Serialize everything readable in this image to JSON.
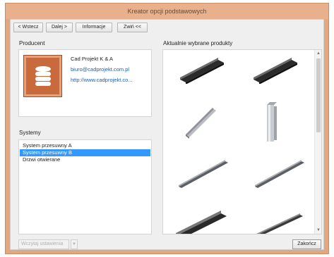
{
  "window": {
    "title": "Kreator opcji podstawowych"
  },
  "toolbar": {
    "back_label": "< Wstecz",
    "next_label": "Dalej >",
    "info_label": "Informacje",
    "collapse_label": "Zwiń <<"
  },
  "producer": {
    "section_label": "Producent",
    "logo_icon": "database-icon",
    "name": "Cad Projekt K & A",
    "email": "biuro@cadprojekt.com.pl",
    "website": "http://www.cadprojekt.co..."
  },
  "systems": {
    "section_label": "Systemy",
    "items": [
      {
        "label": "System przesuwny A",
        "selected": false
      },
      {
        "label": "System przesuwny B",
        "selected": true
      },
      {
        "label": "Drzwi otwierane",
        "selected": false
      }
    ],
    "selection_color": "#3399ff"
  },
  "products": {
    "section_label": "Aktualnie wybrane produkty",
    "items": [
      "aluminium-profile-icon",
      "aluminium-profile-icon",
      "aluminium-profile-icon",
      "aluminium-profile-icon",
      "aluminium-profile-icon",
      "aluminium-profile-icon",
      "aluminium-profile-icon",
      "aluminium-profile-icon"
    ]
  },
  "footer": {
    "load_settings_label": "Wczytaj ustawienia",
    "finish_label": "Zakończ"
  },
  "colors": {
    "window_frame": "#e2a77f",
    "client_background": "#efefef",
    "logo_background": "#c86a3c"
  }
}
